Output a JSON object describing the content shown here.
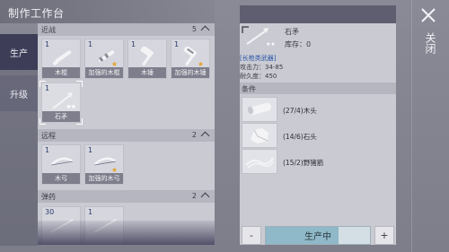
{
  "window": {
    "title": "制作工作台"
  },
  "side_tabs": [
    {
      "label": "生产",
      "active": true
    },
    {
      "label": "升级",
      "active": false
    }
  ],
  "sections": [
    {
      "name": "近战",
      "count": "5",
      "items": [
        {
          "qty": "1",
          "label": "木棍",
          "icon": "stick-icon",
          "badge": ""
        },
        {
          "qty": "1",
          "label": "加强的木棍",
          "icon": "reinforced-stick-icon",
          "badge": "star"
        },
        {
          "qty": "1",
          "label": "木锤",
          "icon": "wooden-hammer-icon",
          "badge": ""
        },
        {
          "qty": "1",
          "label": "加强的木锤",
          "icon": "reinforced-hammer-icon",
          "badge": "star"
        },
        {
          "qty": "1",
          "label": "石矛",
          "icon": "stone-spear-icon",
          "badge": "two-stars",
          "selected": true
        }
      ]
    },
    {
      "name": "远程",
      "count": "2",
      "items": [
        {
          "qty": "1",
          "label": "木弓",
          "icon": "wooden-bow-icon",
          "badge": ""
        },
        {
          "qty": "1",
          "label": "加强的木弓",
          "icon": "reinforced-bow-icon",
          "badge": "star"
        }
      ]
    },
    {
      "name": "弹药",
      "count": "2",
      "items": [
        {
          "qty": "30",
          "label": "",
          "icon": "arrow-icon",
          "badge": ""
        },
        {
          "qty": "1",
          "label": "",
          "icon": "arrow-icon",
          "badge": ""
        }
      ]
    }
  ],
  "detail": {
    "name": "石矛",
    "stock": "库存：0",
    "category": "[长枪类武器]",
    "attack": "攻击力：34-85",
    "durability": "耐久度：450",
    "conditions_header": "条件",
    "materials": [
      {
        "text": "(27/4)木头",
        "icon": "wood-log-icon"
      },
      {
        "text": "(14/6)石头",
        "icon": "stone-icon"
      },
      {
        "text": "(15/2)野猪筋",
        "icon": "boar-sinew-icon"
      }
    ]
  },
  "controls": {
    "minus": "-",
    "plus": "+",
    "produce": "生产中",
    "progress": 0.7
  },
  "close": {
    "label": "关闭"
  },
  "colors": {
    "accent": "#3d3d58",
    "progress": "#8fb8c8",
    "star": "#e7a22a",
    "category": "#2a56a8"
  }
}
